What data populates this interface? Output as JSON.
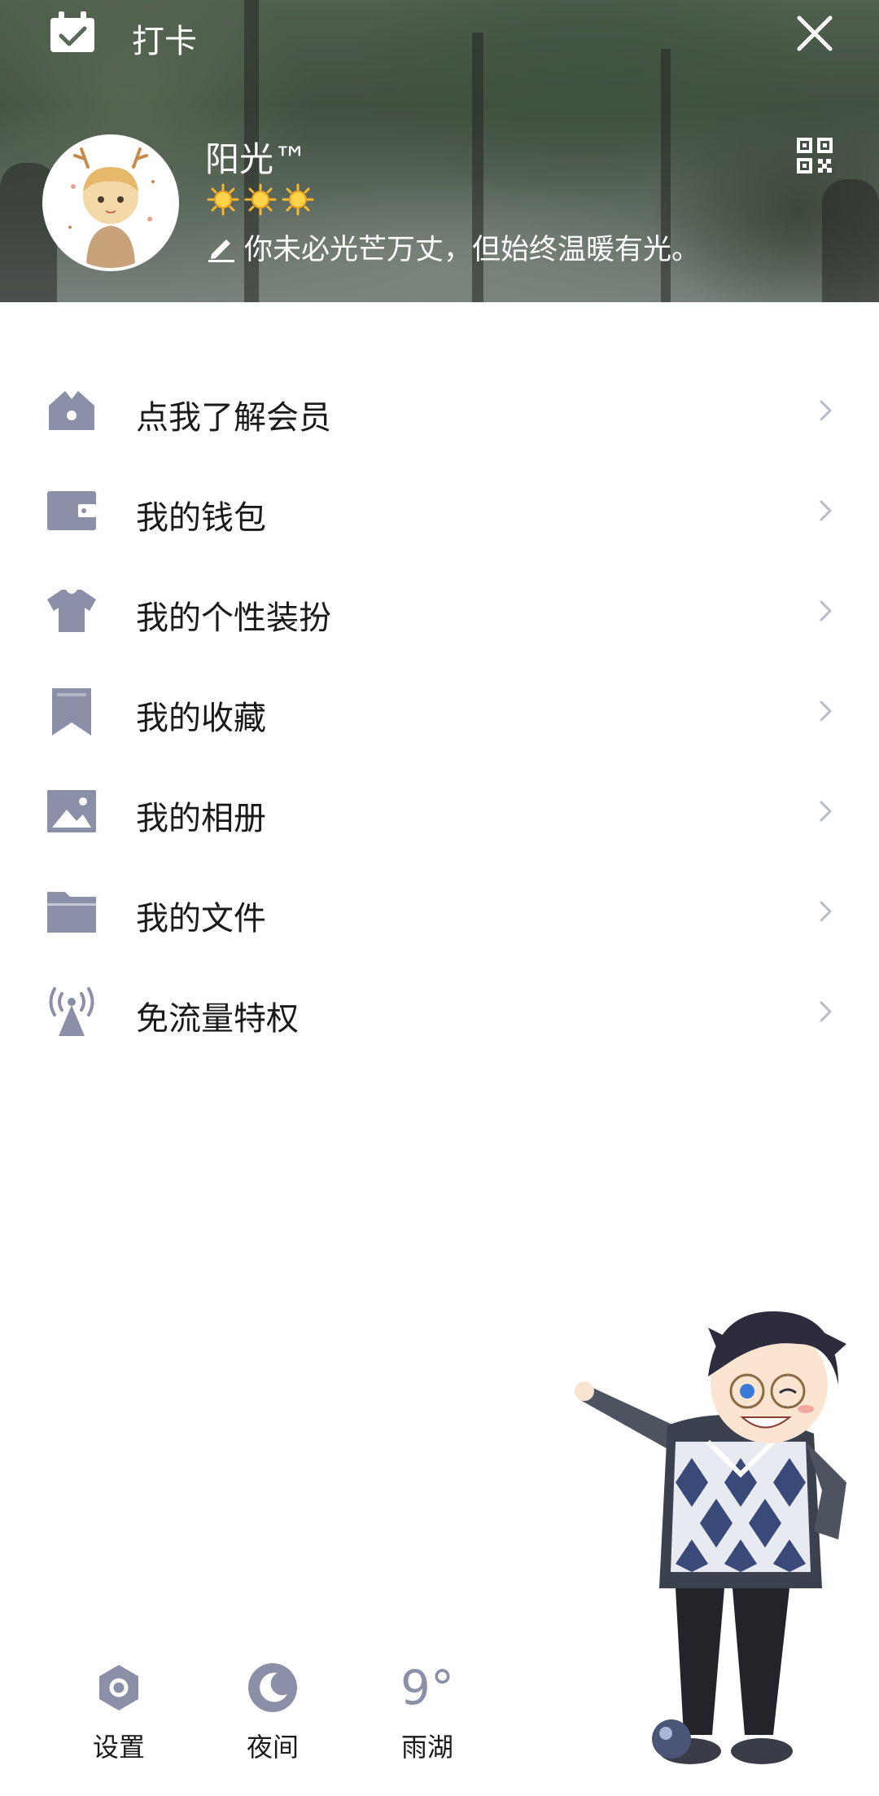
{
  "header": {
    "checkin_label": "打卡",
    "username": "阳光™",
    "level_suns": 3,
    "signature": "你未必光芒万丈，但始终温暖有光。"
  },
  "menu": {
    "items": [
      {
        "label": "点我了解会员",
        "icon": "vip-house-icon"
      },
      {
        "label": "我的钱包",
        "icon": "wallet-icon"
      },
      {
        "label": "我的个性装扮",
        "icon": "tshirt-icon"
      },
      {
        "label": "我的收藏",
        "icon": "bookmark-icon"
      },
      {
        "label": "我的相册",
        "icon": "photo-icon"
      },
      {
        "label": "我的文件",
        "icon": "folder-icon"
      },
      {
        "label": "免流量特权",
        "icon": "signal-tower-icon"
      }
    ]
  },
  "bottom_bar": {
    "settings_label": "设置",
    "night_label": "夜间",
    "weather_temp": "9°",
    "weather_city": "雨湖"
  },
  "colors": {
    "icon": "#8b90a8",
    "text": "#1a1a1a",
    "chevron": "#b8bcc8",
    "header_text": "#ffffff"
  }
}
